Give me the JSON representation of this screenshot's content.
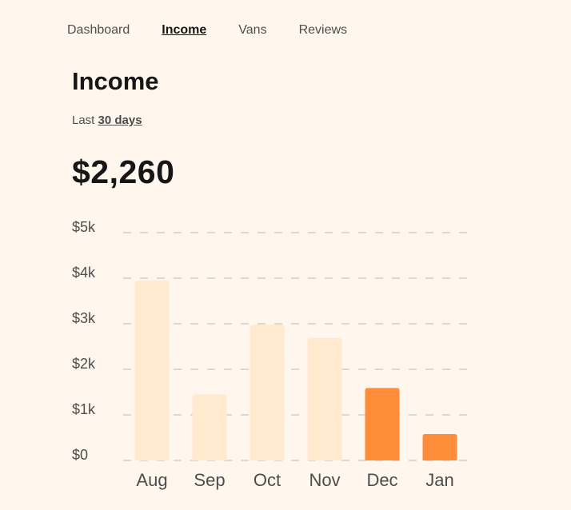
{
  "nav": {
    "items": [
      {
        "label": "Dashboard",
        "active": false
      },
      {
        "label": "Income",
        "active": true
      },
      {
        "label": "Vans",
        "active": false
      },
      {
        "label": "Reviews",
        "active": false
      }
    ]
  },
  "page": {
    "title": "Income",
    "period_prefix": "Last",
    "period_value": "30 days",
    "total": "$2,260"
  },
  "colors": {
    "background": "#FFF7ED",
    "bar_past": "#FFEAD0",
    "bar_recent": "#FF8C38",
    "grid": "#B9B9B9",
    "axis_text": "#4D4D4D"
  },
  "chart_data": {
    "type": "bar",
    "categories": [
      "Aug",
      "Sep",
      "Oct",
      "Nov",
      "Dec",
      "Jan"
    ],
    "values": [
      3950,
      1450,
      2980,
      2690,
      1590,
      580
    ],
    "highlighted": [
      false,
      false,
      false,
      false,
      true,
      true
    ],
    "yticks": [
      "$0",
      "$1k",
      "$2k",
      "$3k",
      "$4k",
      "$5k"
    ],
    "ylim": [
      0,
      5000
    ],
    "grid": true,
    "title": "",
    "xlabel": "",
    "ylabel": ""
  }
}
